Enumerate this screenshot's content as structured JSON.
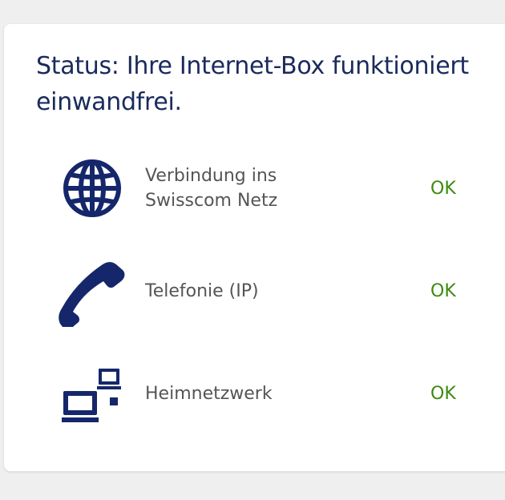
{
  "status": {
    "title": "Status: Ihre Internet-Box funktioniert einwandfrei."
  },
  "items": [
    {
      "icon": "globe-icon",
      "label": "Verbindung ins\nSwisscom Netz",
      "state": "OK"
    },
    {
      "icon": "phone-icon",
      "label": "Telefonie (IP)",
      "state": "OK"
    },
    {
      "icon": "home-network-icon",
      "label": "Heimnetzwerk",
      "state": "OK"
    }
  ],
  "colors": {
    "title": "#1a2a5c",
    "icon": "#15276a",
    "ok": "#3d8a10",
    "label": "#555555"
  }
}
